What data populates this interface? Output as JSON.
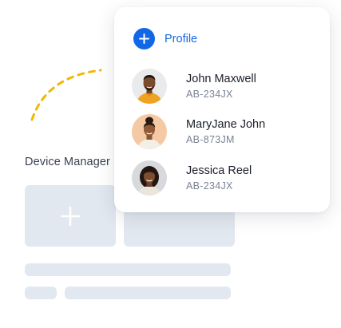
{
  "background": {
    "title": "Device Manager",
    "add_tile_icon": "plus-icon"
  },
  "profile_card": {
    "header_label": "Profile",
    "header_icon": "plus-circle-icon",
    "accent_color": "#1167e6",
    "people": [
      {
        "name": "John Maxwell",
        "id": "AB-234JX"
      },
      {
        "name": "MaryJane John",
        "id": "AB-873JM"
      },
      {
        "name": "Jessica Reel",
        "id": "AB-234JX"
      }
    ]
  }
}
